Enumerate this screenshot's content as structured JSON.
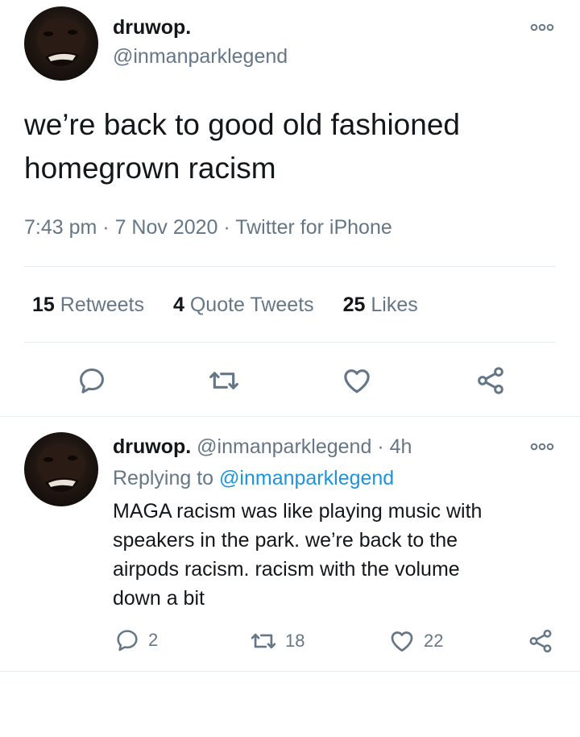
{
  "tweet": {
    "author": {
      "name": "druwop.",
      "handle": "@inmanparklegend"
    },
    "more_icon": "more-icon",
    "text_lines": [
      "we’re back to good old fashioned",
      "homegrown racism"
    ],
    "time": "7:43 pm",
    "date": "7 Nov 2020",
    "source": "Twitter for iPhone",
    "separator": "·",
    "stats": {
      "retweets": {
        "count": "15",
        "label": "Retweets"
      },
      "quotes": {
        "count": "4",
        "label": "Quote Tweets"
      },
      "likes": {
        "count": "25",
        "label": "Likes"
      }
    },
    "actions": [
      "reply-icon",
      "retweet-icon",
      "like-icon",
      "share-icon"
    ]
  },
  "reply": {
    "author": {
      "name": "druwop.",
      "handle": "@inmanparklegend",
      "age": "4h"
    },
    "replying_prefix": "Replying to",
    "replying_to": "@inmanparklegend",
    "text_lines": [
      "MAGA racism was like playing music with",
      "speakers in the park. we’re back to the",
      "airpods racism. racism with the volume",
      "down a bit"
    ],
    "counts": {
      "replies": "2",
      "retweets": "18",
      "likes": "22"
    }
  },
  "colors": {
    "text": "#14171a",
    "muted": "#657786",
    "link": "#1b95e0",
    "divider": "#e6ecf0"
  }
}
